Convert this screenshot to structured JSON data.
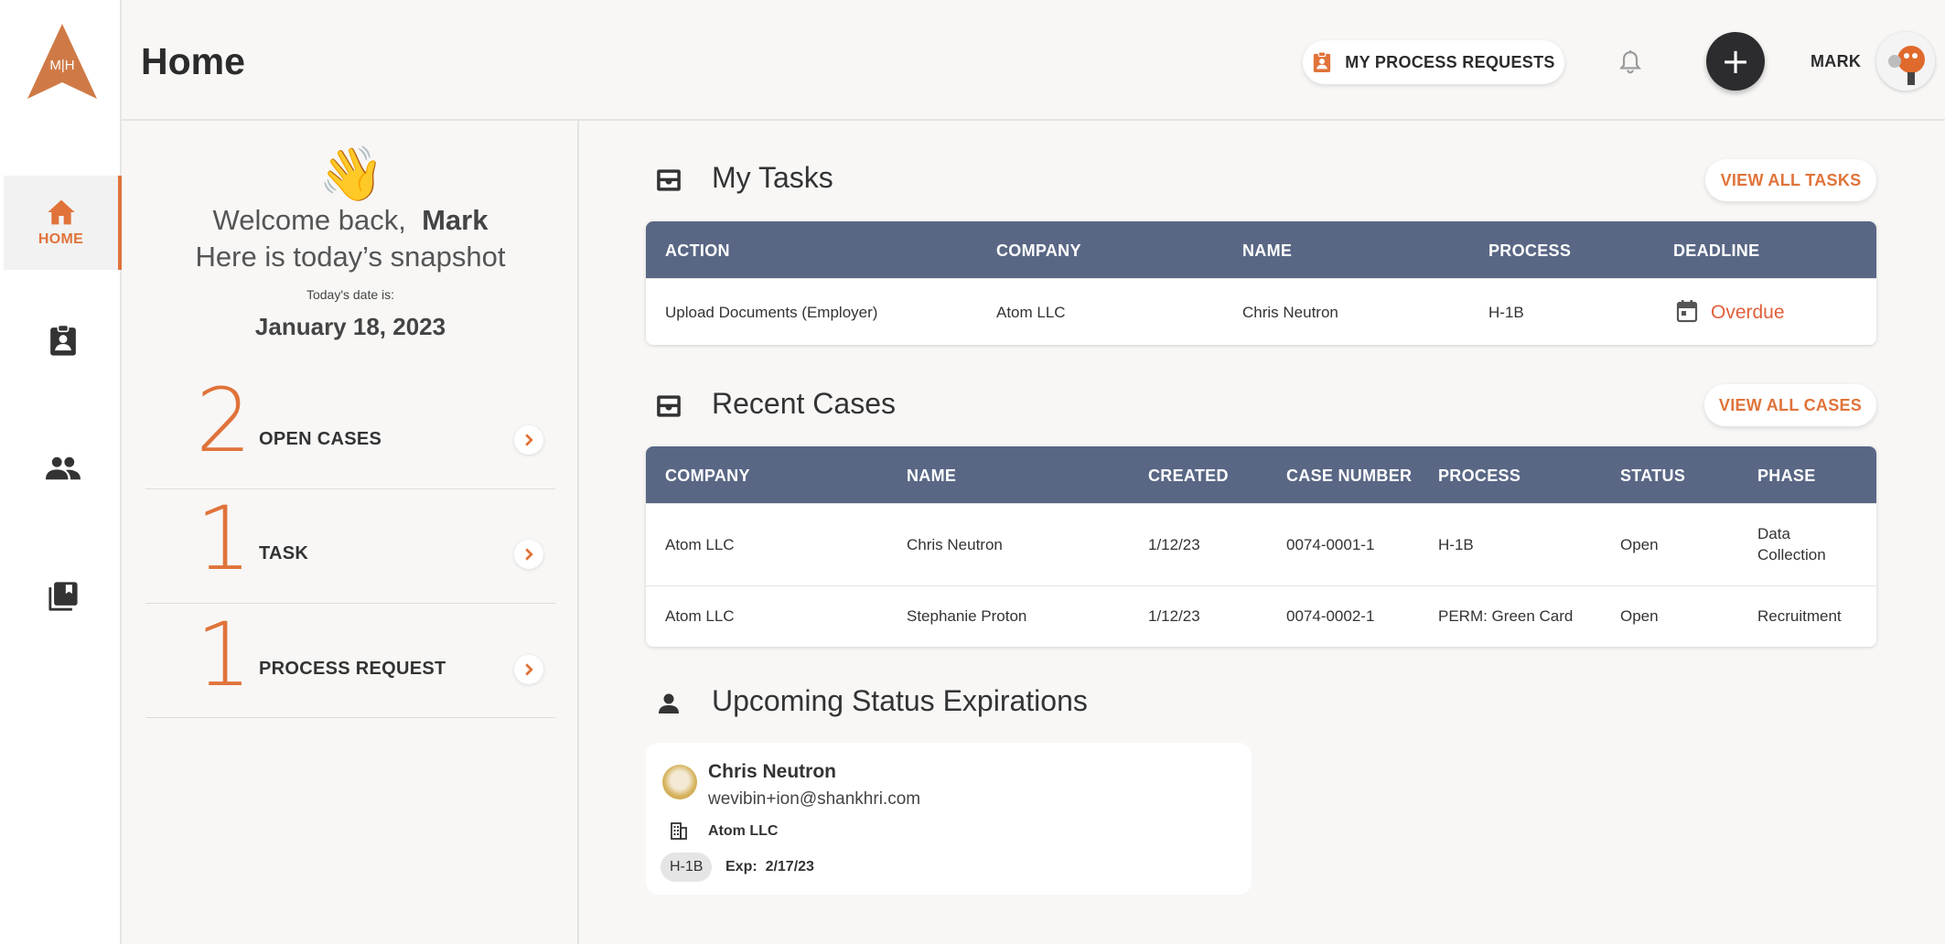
{
  "logo": {
    "letters": "M|H"
  },
  "nav": {
    "home_label": "HOME"
  },
  "header": {
    "title": "Home",
    "process_requests_label": "MY PROCESS REQUESTS",
    "add_label": "+",
    "user_name": "MARK"
  },
  "snapshot": {
    "wave": "👋",
    "welcome_prefix": "Welcome back,",
    "welcome_name": "Mark",
    "subtitle": "Here is today’s snapshot",
    "date_label": "Today's date is:",
    "date_value": "January 18, 2023",
    "stats": [
      {
        "count": "2",
        "label": "OPEN CASES"
      },
      {
        "count": "1",
        "label": "TASK"
      },
      {
        "count": "1",
        "label": "PROCESS REQUEST"
      }
    ]
  },
  "tasks": {
    "title": "My Tasks",
    "view_all_label": "VIEW ALL TASKS",
    "columns": [
      "ACTION",
      "COMPANY",
      "NAME",
      "PROCESS",
      "DEADLINE"
    ],
    "rows": [
      {
        "action": "Upload Documents (Employer)",
        "company": "Atom LLC",
        "name": "Chris Neutron",
        "process": "H-1B",
        "deadline": "Overdue"
      }
    ]
  },
  "cases": {
    "title": "Recent Cases",
    "view_all_label": "VIEW ALL CASES",
    "columns": [
      "COMPANY",
      "NAME",
      "CREATED",
      "CASE NUMBER",
      "PROCESS",
      "STATUS",
      "PHASE"
    ],
    "rows": [
      {
        "company": "Atom LLC",
        "name": "Chris Neutron",
        "created": "1/12/23",
        "case_number": "0074-0001-1",
        "process": "H-1B",
        "status": "Open",
        "phase_line1": "Data",
        "phase_line2": "Collection"
      },
      {
        "company": "Atom LLC",
        "name": "Stephanie Proton",
        "created": "1/12/23",
        "case_number": "0074-0002-1",
        "process": "PERM: Green Card",
        "status": "Open",
        "phase_line1": "Recruitment",
        "phase_line2": ""
      }
    ]
  },
  "expirations": {
    "title": "Upcoming Status Expirations",
    "card": {
      "name": "Chris Neutron",
      "email": "wevibin+ion@shankhri.com",
      "company": "Atom LLC",
      "visa": "H-1B",
      "exp_label": "Exp:",
      "exp_date": "2/17/23"
    }
  },
  "colors": {
    "accent": "#e0733a",
    "table_header": "#596785",
    "dark_button": "#2c2c2e"
  }
}
